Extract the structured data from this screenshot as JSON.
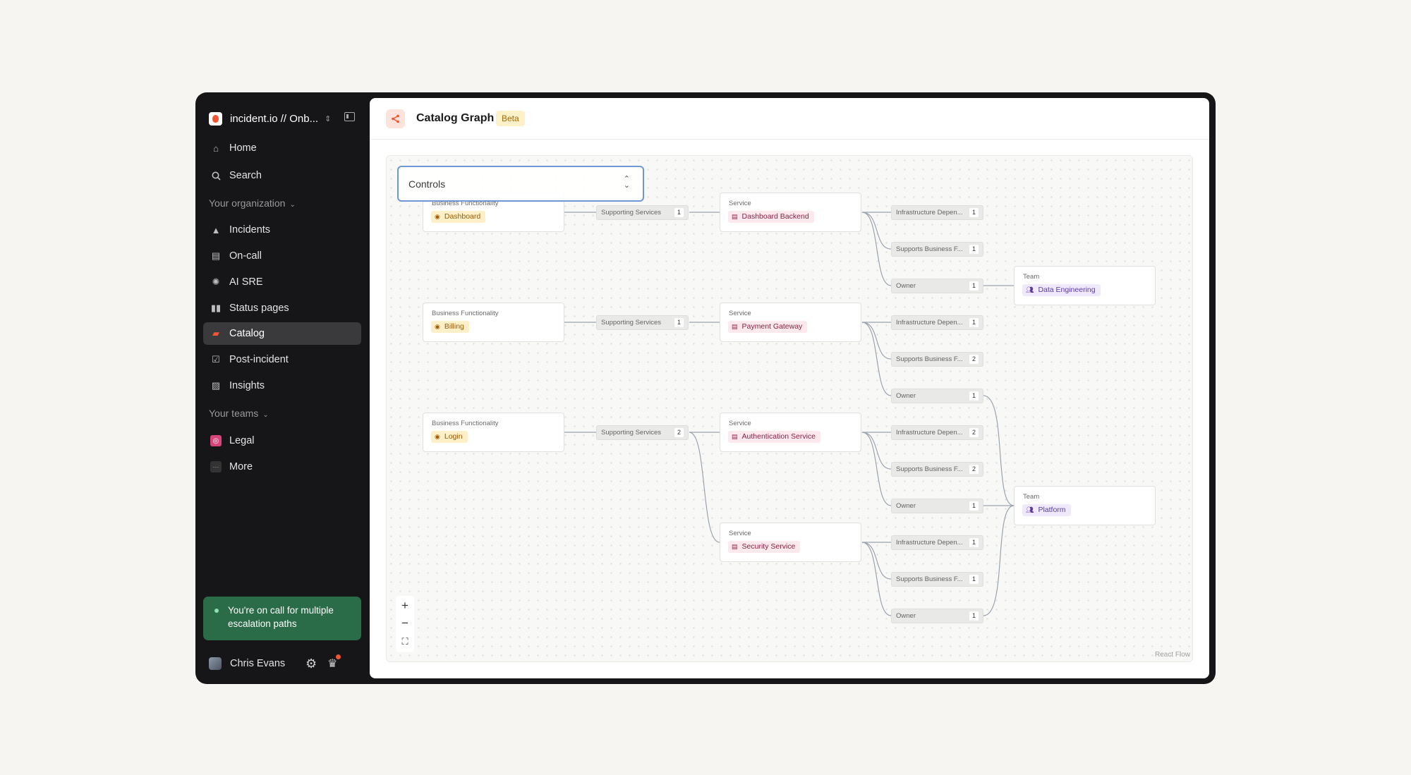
{
  "sidebar": {
    "org_name": "incident.io // Onb...",
    "items": {
      "home": "Home",
      "search": "Search",
      "incidents": "Incidents",
      "oncall": "On-call",
      "aisre": "AI SRE",
      "status_pages": "Status pages",
      "catalog": "Catalog",
      "post_incident": "Post-incident",
      "insights": "Insights",
      "legal": "Legal",
      "more": "More"
    },
    "sections": {
      "org": "Your organization",
      "teams": "Your teams"
    },
    "active_item": "Catalog",
    "oncall_banner": "You're on call for multiple escalation paths",
    "user_name": "Chris Evans"
  },
  "header": {
    "title": "Catalog Graph",
    "badge": "Beta"
  },
  "graph": {
    "controls_label": "Controls",
    "attribution": "React Flow",
    "business_functionalities": [
      {
        "type": "Business Functionality",
        "name": "Dashboard"
      },
      {
        "type": "Business Functionality",
        "name": "Billing"
      },
      {
        "type": "Business Functionality",
        "name": "Login"
      }
    ],
    "supporting_services": [
      {
        "label": "Supporting Services",
        "count": "1"
      },
      {
        "label": "Supporting Services",
        "count": "1"
      },
      {
        "label": "Supporting Services",
        "count": "2"
      }
    ],
    "services": [
      {
        "type": "Service",
        "name": "Dashboard Backend"
      },
      {
        "type": "Service",
        "name": "Payment Gateway"
      },
      {
        "type": "Service",
        "name": "Authentication Service"
      },
      {
        "type": "Service",
        "name": "Security Service"
      }
    ],
    "service_relations": [
      [
        {
          "label": "Infrastructure Depen...",
          "count": "1"
        },
        {
          "label": "Supports Business F...",
          "count": "1"
        },
        {
          "label": "Owner",
          "count": "1"
        }
      ],
      [
        {
          "label": "Infrastructure Depen...",
          "count": "1"
        },
        {
          "label": "Supports Business F...",
          "count": "2"
        },
        {
          "label": "Owner",
          "count": "1"
        }
      ],
      [
        {
          "label": "Infrastructure Depen...",
          "count": "2"
        },
        {
          "label": "Supports Business F...",
          "count": "2"
        },
        {
          "label": "Owner",
          "count": "1"
        }
      ],
      [
        {
          "label": "Infrastructure Depen...",
          "count": "1"
        },
        {
          "label": "Supports Business F...",
          "count": "1"
        },
        {
          "label": "Owner",
          "count": "1"
        }
      ]
    ],
    "teams": [
      {
        "type": "Team",
        "name": "Data Engineering"
      },
      {
        "type": "Team",
        "name": "Platform"
      }
    ]
  },
  "colors": {
    "accent": "#f25533",
    "sidebar_bg": "#161618",
    "oncall_banner": "#2a6b48",
    "controls_border": "#6f97d8"
  }
}
